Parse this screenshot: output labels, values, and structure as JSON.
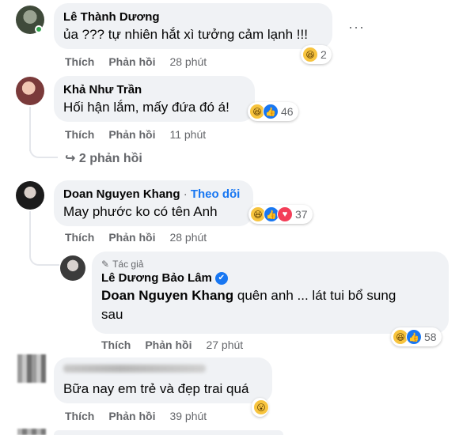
{
  "comments": [
    {
      "author": "Lê Thành Dương",
      "text": "ủa ??? tự nhiên hắt xì tưởng cảm lạnh !!!",
      "like": "Thích",
      "reply": "Phản hồi",
      "time": "28 phút",
      "reaction_count": "2",
      "more": "···"
    },
    {
      "author": "Khả Như Trần",
      "text": "Hối hận lắm, mấy đứa đó á!",
      "like": "Thích",
      "reply": "Phản hồi",
      "time": "11 phút",
      "reaction_count": "46",
      "replies_link": "2 phản hồi"
    },
    {
      "author": "Doan Nguyen Khang",
      "separator": "·",
      "follow": "Theo dõi",
      "text": "May phước ko có tên Anh",
      "like": "Thích",
      "reply": "Phản hồi",
      "time": "28 phút",
      "reaction_count": "37"
    },
    {
      "author_tag": "Tác giả",
      "author": "Lê Dương Bảo Lâm",
      "mention": "Doan Nguyen Khang",
      "text_line1": " quên anh ... lát tui bổ sung",
      "text_line2": "sau",
      "like": "Thích",
      "reply": "Phản hồi",
      "time": "27 phút",
      "reaction_count": "58"
    },
    {
      "author": "",
      "text": "Bữa nay em trẻ và đẹp trai quá",
      "like": "Thích",
      "reply": "Phản hồi",
      "time": "39 phút"
    }
  ],
  "icons": {
    "haha": "😆",
    "like": "👍",
    "love": "♥",
    "wow": "😮",
    "pencil": "✎",
    "check": "✔",
    "reply_arrow": "↪"
  }
}
